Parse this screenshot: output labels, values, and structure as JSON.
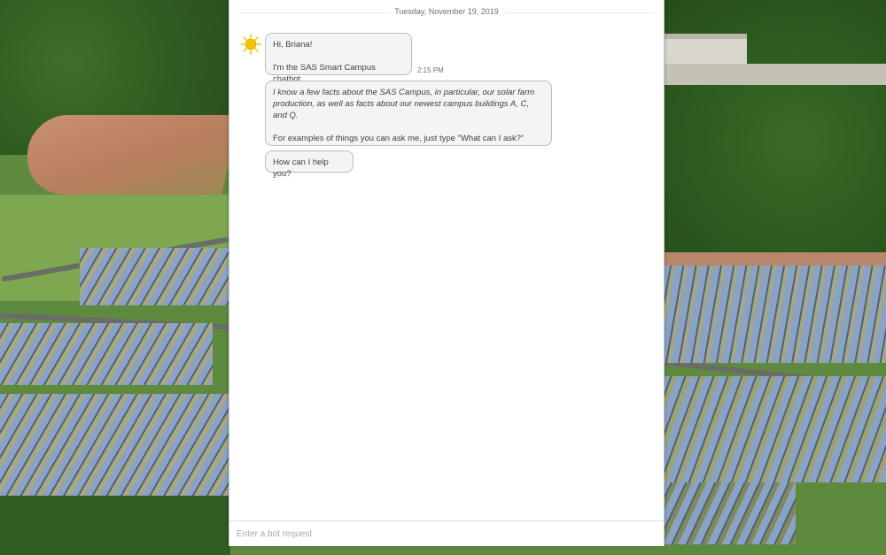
{
  "conversation": {
    "date": "Tuesday, November 19, 2019",
    "bot_avatar_icon": "sun-icon",
    "messages": [
      {
        "sender": "bot",
        "lines": [
          "Hi, Briana!",
          "I'm the SAS Smart Campus chatbot."
        ],
        "time": "2:15 PM"
      },
      {
        "sender": "bot",
        "italic_text": "I know a few facts about the SAS Campus, in particular, our solar farm production, as well as facts about our newest campus buildings A, C, and Q.",
        "text": "For examples of things you can ask me, just type \"What can I ask?\""
      },
      {
        "sender": "bot",
        "text": "How can I help you?"
      }
    ]
  },
  "input": {
    "placeholder": "Enter a bot request",
    "value": ""
  },
  "colors": {
    "bubble_bg": "#f3f4f6",
    "bubble_border": "#b9bcc2",
    "sun": "#f5c400"
  }
}
